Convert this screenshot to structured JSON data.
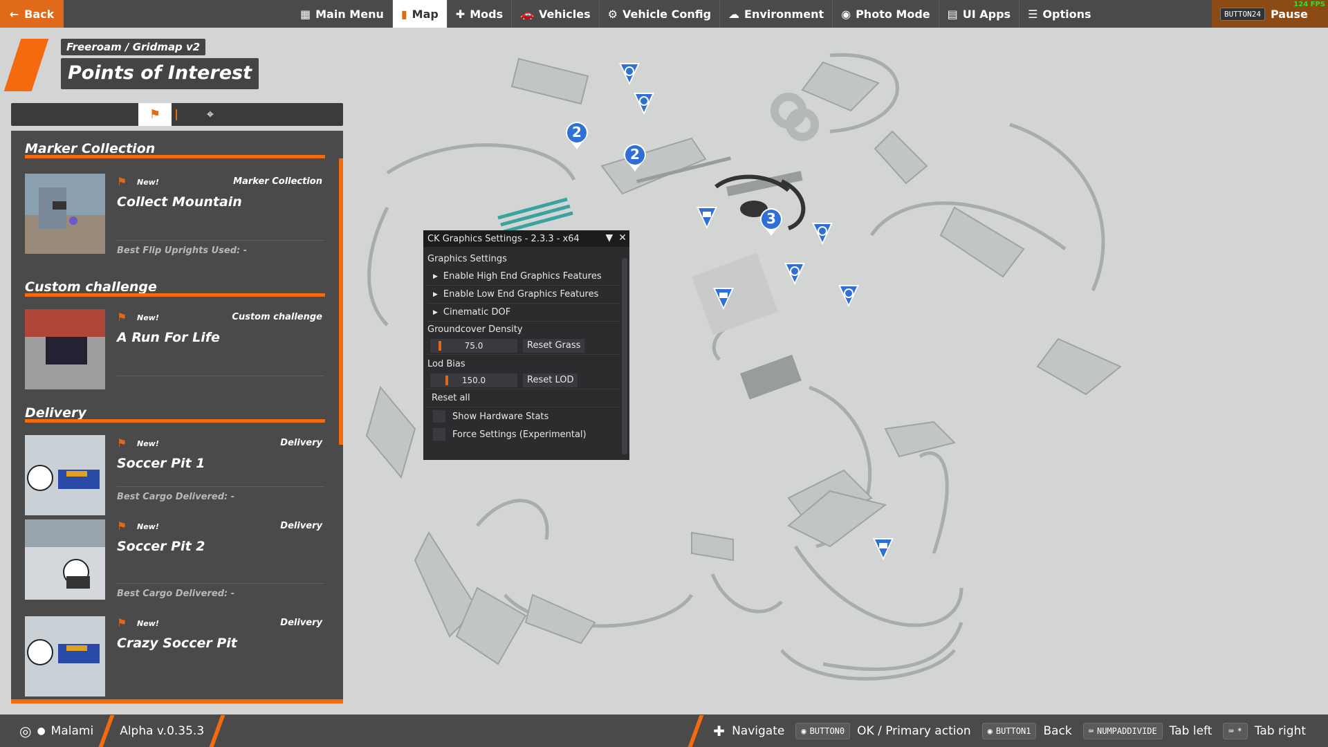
{
  "topbar": {
    "back_label": "Back",
    "nav": [
      {
        "label": "Main Menu",
        "icon": "grid-icon",
        "active": false
      },
      {
        "label": "Map",
        "icon": "map-icon",
        "active": true
      },
      {
        "label": "Mods",
        "icon": "puzzle-icon",
        "active": false
      },
      {
        "label": "Vehicles",
        "icon": "car-icon",
        "active": false
      },
      {
        "label": "Vehicle Config",
        "icon": "car-config-icon",
        "active": false
      },
      {
        "label": "Environment",
        "icon": "weather-icon",
        "active": false
      },
      {
        "label": "Photo Mode",
        "icon": "camera-icon",
        "active": false
      },
      {
        "label": "UI Apps",
        "icon": "ui-apps-icon",
        "active": false
      },
      {
        "label": "Options",
        "icon": "sliders-icon",
        "active": false
      }
    ],
    "pause_key": "BUTTON24",
    "pause_label": "Pause",
    "fps": "124 FPS"
  },
  "header": {
    "breadcrumb": "Freeroam / Gridmap v2",
    "title": "Points of Interest"
  },
  "sections": [
    {
      "title": "Marker Collection",
      "cards": [
        {
          "badge": "New!",
          "category": "Marker Collection",
          "name": "Collect Mountain",
          "stat": "Best Flip Uprights Used: -"
        }
      ]
    },
    {
      "title": "Custom challenge",
      "cards": [
        {
          "badge": "New!",
          "category": "Custom challenge",
          "name": "A Run For Life",
          "stat": ""
        }
      ]
    },
    {
      "title": "Delivery",
      "cards": [
        {
          "badge": "New!",
          "category": "Delivery",
          "name": "Soccer Pit 1",
          "stat": "Best Cargo Delivered: -"
        },
        {
          "badge": "New!",
          "category": "Delivery",
          "name": "Soccer Pit 2",
          "stat": "Best Cargo Delivered: -"
        },
        {
          "badge": "New!",
          "category": "Delivery",
          "name": "Crazy Soccer Pit",
          "stat": ""
        }
      ]
    }
  ],
  "graphics_window": {
    "title": "CK Graphics Settings - 2.3.3 - x64",
    "section": "Graphics Settings",
    "tree_items": [
      "Enable High End Graphics Features",
      "Enable Low End Graphics Features",
      "Cinematic DOF"
    ],
    "groundcover": {
      "label": "Groundcover Density",
      "value": "75.0",
      "button": "Reset Grass"
    },
    "lod": {
      "label": "Lod Bias",
      "value": "150.0",
      "button": "Reset LOD"
    },
    "reset_all": "Reset all",
    "checkboxes": [
      {
        "label": "Show Hardware Stats",
        "checked": false
      },
      {
        "label": "Force Settings (Experimental)",
        "checked": false
      }
    ]
  },
  "map_markers": [
    {
      "type": "timer",
      "label": ""
    },
    {
      "type": "timer",
      "label": ""
    },
    {
      "type": "cluster",
      "label": "2"
    },
    {
      "type": "cluster",
      "label": "2"
    },
    {
      "type": "cluster",
      "label": "3"
    },
    {
      "type": "delivery",
      "label": ""
    },
    {
      "type": "timer",
      "label": ""
    },
    {
      "type": "timer",
      "label": ""
    },
    {
      "type": "delivery",
      "label": ""
    },
    {
      "type": "timer",
      "label": ""
    },
    {
      "type": "delivery",
      "label": ""
    }
  ],
  "bottombar": {
    "user": "Malami",
    "version": "Alpha v.0.35.3",
    "hints": [
      {
        "key": "",
        "label": "Navigate",
        "icon": "dpad-icon"
      },
      {
        "key": "BUTTON0",
        "label": "OK / Primary action",
        "icon": "gamepad-icon"
      },
      {
        "key": "BUTTON1",
        "label": "Back",
        "icon": "gamepad-icon"
      },
      {
        "key": "NUMPADDIVIDE",
        "label": "Tab left",
        "icon": "keyboard-icon"
      },
      {
        "key": "*",
        "label": "Tab right",
        "icon": "keyboard-icon"
      }
    ]
  },
  "colors": {
    "accent": "#f36a0f",
    "panel": "#4a4a4a",
    "marker_blue": "#2f6fd6"
  }
}
